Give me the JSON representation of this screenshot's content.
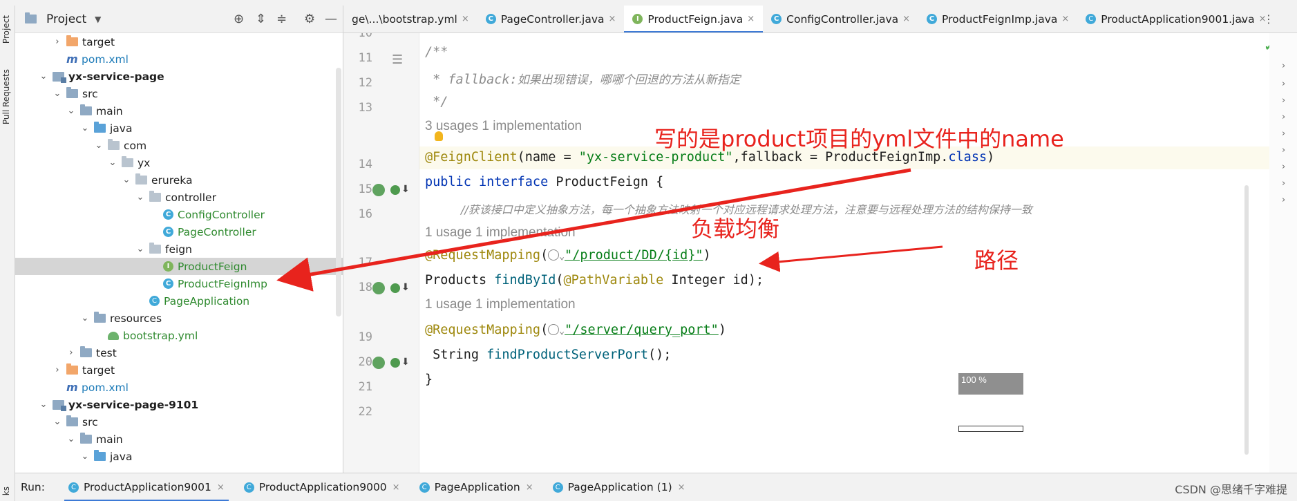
{
  "toolstrip": {
    "project_tab": "Project",
    "pull_requests_tab": "Pull Requests",
    "bottom_tab": "ks"
  },
  "project_panel": {
    "title": "Project",
    "tree": [
      {
        "label": "target",
        "icon": "folder-orange-icon",
        "depth": 2,
        "chevron": "›"
      },
      {
        "label": "pom.xml",
        "icon": "maven-icon",
        "depth": 2,
        "chevron": ""
      },
      {
        "label": "yx-service-page",
        "icon": "module-icon",
        "depth": 1,
        "chevron": "⌄"
      },
      {
        "label": "src",
        "icon": "folder-icon",
        "depth": 2,
        "chevron": "⌄"
      },
      {
        "label": "main",
        "icon": "folder-icon",
        "depth": 3,
        "chevron": "⌄"
      },
      {
        "label": "java",
        "icon": "folder-blue-icon",
        "depth": 4,
        "chevron": "⌄"
      },
      {
        "label": "com",
        "icon": "package-icon",
        "depth": 5,
        "chevron": "⌄"
      },
      {
        "label": "yx",
        "icon": "package-icon",
        "depth": 6,
        "chevron": "⌄"
      },
      {
        "label": "erureka",
        "icon": "package-icon",
        "depth": 7,
        "chevron": "⌄"
      },
      {
        "label": "controller",
        "icon": "package-icon",
        "depth": 8,
        "chevron": "⌄"
      },
      {
        "label": "ConfigController",
        "icon": "class-icon",
        "depth": 9,
        "chevron": ""
      },
      {
        "label": "PageController",
        "icon": "class-icon",
        "depth": 9,
        "chevron": ""
      },
      {
        "label": "feign",
        "icon": "package-icon",
        "depth": 8,
        "chevron": "⌄"
      },
      {
        "label": "ProductFeign",
        "icon": "interface-icon",
        "depth": 9,
        "chevron": "",
        "selected": true
      },
      {
        "label": "ProductFeignImp",
        "icon": "class-icon",
        "depth": 9,
        "chevron": ""
      },
      {
        "label": "PageApplication",
        "icon": "app-icon",
        "depth": 8,
        "chevron": ""
      },
      {
        "label": "resources",
        "icon": "folder-resources-icon",
        "depth": 4,
        "chevron": "⌄"
      },
      {
        "label": "bootstrap.yml",
        "icon": "yml-icon",
        "depth": 5,
        "chevron": ""
      },
      {
        "label": "test",
        "icon": "folder-icon",
        "depth": 3,
        "chevron": "›"
      },
      {
        "label": "target",
        "icon": "folder-orange-icon",
        "depth": 2,
        "chevron": "›"
      },
      {
        "label": "pom.xml",
        "icon": "maven-icon",
        "depth": 2,
        "chevron": ""
      },
      {
        "label": "yx-service-page-9101",
        "icon": "module-icon",
        "depth": 1,
        "chevron": "⌄"
      },
      {
        "label": "src",
        "icon": "folder-icon",
        "depth": 2,
        "chevron": "⌄"
      },
      {
        "label": "main",
        "icon": "folder-icon",
        "depth": 3,
        "chevron": "⌄"
      },
      {
        "label": "java",
        "icon": "folder-blue-icon",
        "depth": 4,
        "chevron": "⌄"
      }
    ]
  },
  "tabs": [
    {
      "label": "ge\\...\\bootstrap.yml",
      "icon": "yml-icon",
      "active": false
    },
    {
      "label": "PageController.java",
      "icon": "class-icon",
      "active": false
    },
    {
      "label": "ProductFeign.java",
      "icon": "interface-icon",
      "active": true
    },
    {
      "label": "ConfigController.java",
      "icon": "class-icon",
      "active": false
    },
    {
      "label": "ProductFeignImp.java",
      "icon": "class-icon",
      "active": false
    },
    {
      "label": "ProductApplication9001.java",
      "icon": "app-icon",
      "active": false
    }
  ],
  "editor": {
    "line_numbers": [
      "10",
      "11",
      "12",
      "13",
      "14",
      "15",
      "16",
      "17",
      "18",
      "19",
      "20",
      "21",
      "22"
    ],
    "comment_open": "/**",
    "comment_body_tag": " * fallback:",
    "comment_body_text": "如果出现错误，哪哪个回退的方法从新指定",
    "comment_close": " */",
    "hint_top": "3 usages   1 implementation",
    "annotation_feign": "@FeignClient",
    "feign_args_a": "(name = ",
    "feign_name_value": "\"yx-service-product\"",
    "feign_args_b": ",fallback = ProductFeignImp.",
    "feign_class_kw": "class",
    "feign_args_c": ")",
    "kw_public": "public",
    "kw_interface": "interface",
    "iface_name": " ProductFeign {",
    "line16_comment": "//获该接口中定义抽象方法，每一个抽象方法映射一个对应远程请求处理方法，注意要与远程处理方法的结构保持一致",
    "hint_1": "1 usage   1 implementation",
    "annotation_mapping": "@RequestMapping",
    "mapping_open": "(",
    "mapping_path_1": "\"/product/DD/{id}\"",
    "mapping_close": ")",
    "line18_type": "Products ",
    "line18_method": "findById",
    "line18_paren": "(",
    "line18_ann": "@PathVariable",
    "line18_rest": " Integer id);",
    "hint_2": "1 usage   1 implementation",
    "mapping_path_2": "\"/server/query_port\"",
    "line20_type": " String ",
    "line20_method": "findProductServerPort",
    "line20_rest": "();",
    "line21": "}",
    "zoom_label": "100 %"
  },
  "annotations": {
    "note_name": "写的是product项目的yml文件中的name",
    "note_load_balance": "负载均衡",
    "note_path": "路径"
  },
  "run_bar": {
    "label": "Run:",
    "tabs": [
      {
        "label": "ProductApplication9001",
        "active": true
      },
      {
        "label": "ProductApplication9000",
        "active": false
      },
      {
        "label": "PageApplication",
        "active": false
      },
      {
        "label": "PageApplication (1)",
        "active": false
      }
    ],
    "watermark": "CSDN @思绪千字难提"
  },
  "colors": {
    "annotation_red": "#e8231d",
    "active_tab_underline": "#3d7ad6",
    "selected_row": "#d5d5d5"
  }
}
